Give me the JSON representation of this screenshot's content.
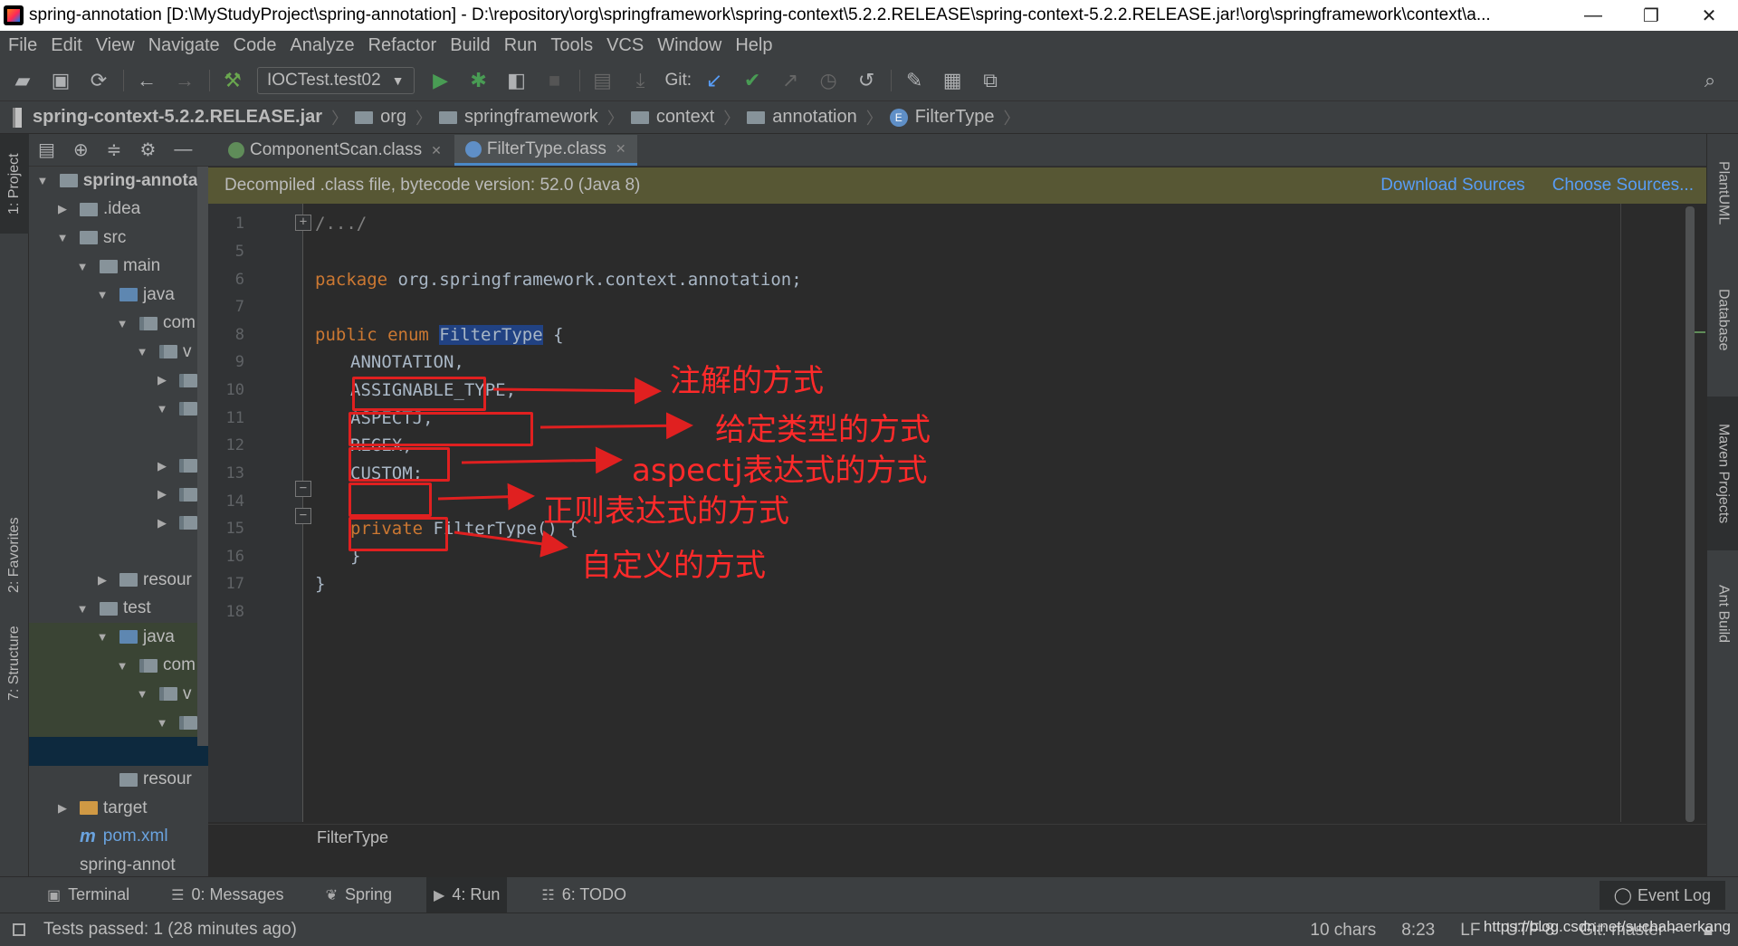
{
  "window": {
    "title": "spring-annotation [D:\\MyStudyProject\\spring-annotation] - D:\\repository\\org\\springframework\\spring-context\\5.2.2.RELEASE\\spring-context-5.2.2.RELEASE.jar!\\org\\springframework\\context\\a...",
    "minimize": "—",
    "restore": "❐",
    "close": "✕"
  },
  "menu": [
    "File",
    "Edit",
    "View",
    "Navigate",
    "Code",
    "Analyze",
    "Refactor",
    "Build",
    "Run",
    "Tools",
    "VCS",
    "Window",
    "Help"
  ],
  "toolbar": {
    "run_config": "IOCTest.test02",
    "git_label": "Git:"
  },
  "navbar": {
    "crumbs": [
      "spring-context-5.2.2.RELEASE.jar",
      "org",
      "springframework",
      "context",
      "annotation",
      "FilterType"
    ]
  },
  "left_tabs": {
    "project": "1: Project",
    "favorites": "2: Favorites",
    "structure": "7: Structure"
  },
  "project_tree": [
    {
      "label": "spring-annotati",
      "indent": 0,
      "arrow": "▼",
      "icon": "module",
      "bold": true
    },
    {
      "label": ".idea",
      "indent": 1,
      "arrow": "▶",
      "icon": "folder"
    },
    {
      "label": "src",
      "indent": 1,
      "arrow": "▼",
      "icon": "folder"
    },
    {
      "label": "main",
      "indent": 2,
      "arrow": "▼",
      "icon": "folder"
    },
    {
      "label": "java",
      "indent": 3,
      "arrow": "▼",
      "icon": "blue"
    },
    {
      "label": "com",
      "indent": 4,
      "arrow": "▼",
      "icon": "pkg"
    },
    {
      "label": "v",
      "indent": 5,
      "arrow": "▼",
      "icon": "pkg"
    },
    {
      "label": "",
      "indent": 6,
      "arrow": "▶",
      "icon": "pkg"
    },
    {
      "label": "",
      "indent": 6,
      "arrow": "▼",
      "icon": "pkg"
    },
    {
      "label": "",
      "indent": 6,
      "arrow": "",
      "icon": ""
    },
    {
      "label": "",
      "indent": 6,
      "arrow": "▶",
      "icon": "pkg"
    },
    {
      "label": "",
      "indent": 6,
      "arrow": "▶",
      "icon": "pkg"
    },
    {
      "label": "",
      "indent": 6,
      "arrow": "▶",
      "icon": "pkg"
    },
    {
      "label": "",
      "indent": 6,
      "arrow": "",
      "icon": ""
    },
    {
      "label": "resour",
      "indent": 3,
      "arrow": "▶",
      "icon": "folder"
    },
    {
      "label": "test",
      "indent": 2,
      "arrow": "▼",
      "icon": "folder"
    },
    {
      "label": "java",
      "indent": 3,
      "arrow": "▼",
      "icon": "blue",
      "green": true
    },
    {
      "label": "com",
      "indent": 4,
      "arrow": "▼",
      "icon": "pkg",
      "green": true
    },
    {
      "label": "v",
      "indent": 5,
      "arrow": "▼",
      "icon": "pkg",
      "green": true
    },
    {
      "label": "",
      "indent": 6,
      "arrow": "▼",
      "icon": "pkg",
      "green": true
    },
    {
      "label": "",
      "indent": 6,
      "arrow": "",
      "icon": "",
      "selected": true
    },
    {
      "label": "resour",
      "indent": 3,
      "arrow": "",
      "icon": "folder"
    },
    {
      "label": "target",
      "indent": 1,
      "arrow": "▶",
      "icon": "orange"
    },
    {
      "label": "pom.xml",
      "indent": 1,
      "arrow": "",
      "icon": "maven"
    },
    {
      "label": "spring-annot",
      "indent": 1,
      "arrow": "",
      "icon": ""
    }
  ],
  "tabs": [
    {
      "label": "ComponentScan.class",
      "active": false
    },
    {
      "label": "FilterType.class",
      "active": true
    }
  ],
  "decompiled_banner": {
    "text": "Decompiled .class file, bytecode version: 52.0 (Java 8)",
    "download": "Download Sources",
    "choose": "Choose Sources..."
  },
  "line_numbers": [
    "1",
    "5",
    "6",
    "7",
    "8",
    "9",
    "10",
    "11",
    "12",
    "13",
    "14",
    "15",
    "16",
    "17",
    "18"
  ],
  "code": {
    "l1": "/.../",
    "l6_kw": "package",
    "l6_rest": " org.springframework.context.annotation;",
    "l8_kw": "public enum ",
    "l8_name": "FilterType",
    "l8_rest": " {",
    "l9": "ANNOTATION,",
    "l10": "ASSIGNABLE_TYPE,",
    "l11": "ASPECTJ,",
    "l12": "REGEX,",
    "l13": "CUSTOM;",
    "l15_kw": "private ",
    "l15_rest": "FilterType() {",
    "l16": "}",
    "l17": "}"
  },
  "annotations": {
    "a1": "注解的方式",
    "a2": "给定类型的方式",
    "a3": "aspectj表达式的方式",
    "a4": "正则表达式的方式",
    "a5": "自定义的方式"
  },
  "editor_breadcrumb": "FilterType",
  "right_tabs": [
    "PlantUML",
    "Database",
    "Maven Projects",
    "Ant Build"
  ],
  "bottom_tools": [
    {
      "label": "Terminal",
      "icon": "▣",
      "active": false
    },
    {
      "label": "0: Messages",
      "icon": "☰",
      "active": false
    },
    {
      "label": "Spring",
      "icon": "❦",
      "active": false
    },
    {
      "label": "4: Run",
      "icon": "▶",
      "active": true
    },
    {
      "label": "6: TODO",
      "icon": "☷",
      "active": false
    }
  ],
  "event_log": "Event Log",
  "status": {
    "message": "Tests passed: 1 (28 minutes ago)",
    "chars": "10 chars",
    "position": "8:23",
    "line_sep": "LF",
    "encoding": "UTF-8",
    "git": "Git: master ÷"
  },
  "watermark": "https://blog.csdn.net/suchahaerkang",
  "colors": {
    "annotation_red": "#ff2a2a",
    "keyword": "#cc7832",
    "identifier": "#a9b7c6",
    "selection": "#214283",
    "banner": "#575734",
    "link": "#589df6"
  }
}
